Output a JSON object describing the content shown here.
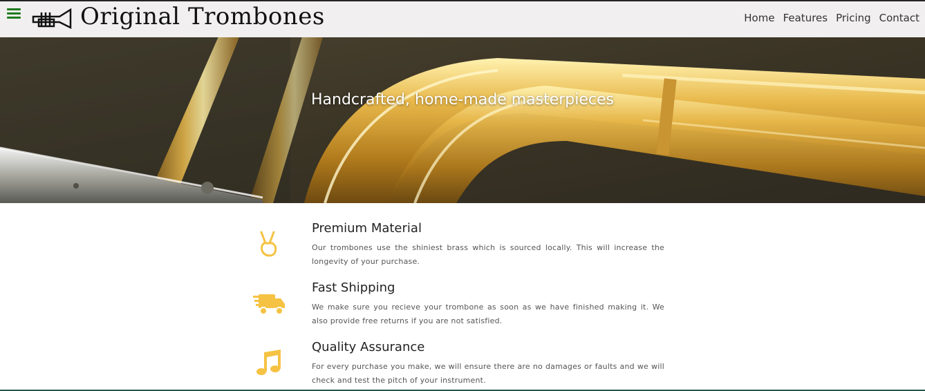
{
  "header": {
    "brand": "Original Trombones",
    "nav": [
      {
        "label": "Home"
      },
      {
        "label": "Features"
      },
      {
        "label": "Pricing"
      },
      {
        "label": "Contact"
      }
    ]
  },
  "hero": {
    "title": "Handcrafted, home-made masterpieces"
  },
  "features": [
    {
      "icon": "peace-hand-icon",
      "title": "Premium Material",
      "text": "Our trombones use the shiniest brass which is sourced locally. This will increase the longevity of your purchase."
    },
    {
      "icon": "shipping-truck-icon",
      "title": "Fast Shipping",
      "text": "We make sure you recieve your trombone as soon as we have finished making it. We also provide free returns if you are not satisfied."
    },
    {
      "icon": "music-note-icon",
      "title": "Quality Assurance",
      "text": "For every purchase you make, we will ensure there are no damages or faults and we will check and test the pitch of your instrument."
    }
  ],
  "colors": {
    "accent": "#f5c243",
    "hamburger": "#1f7a1f",
    "header_bg": "#f0eeee"
  }
}
